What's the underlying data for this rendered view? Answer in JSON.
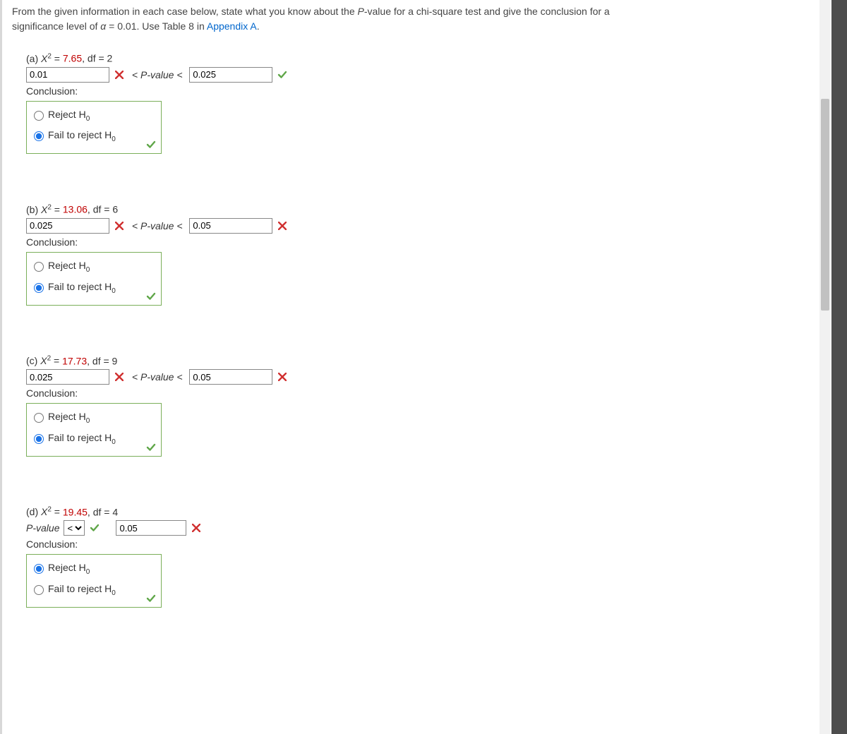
{
  "intro": {
    "line1_a": "From the given information in each case below, state what you know about the ",
    "line1_b": "P",
    "line1_c": "-value for a chi-square test and give the conclusion for a",
    "line2_a": "significance level of ",
    "alpha": "α",
    "line2_b": " = 0.01. Use Table 8 in ",
    "link": "Appendix A",
    "line2_c": "."
  },
  "common": {
    "pvalue_middle": "< P-value <",
    "pvalue_prefix": "P-value",
    "conclusion": "Conclusion:",
    "reject": "Reject H",
    "fail": "Fail to reject H",
    "sub0": "0"
  },
  "parts": {
    "a": {
      "label": "(a) X² = ",
      "stat": "7.65",
      "df": ", df = 2",
      "low": "0.01",
      "high": "0.025",
      "low_correct": false,
      "high_correct": true,
      "selected": "fail",
      "box_correct": true
    },
    "b": {
      "label": "(b) X² = ",
      "stat": "13.06",
      "df": ", df = 6",
      "low": "0.025",
      "high": "0.05",
      "low_correct": false,
      "high_correct": false,
      "selected": "fail",
      "box_correct": true
    },
    "c": {
      "label": "(c) X² = ",
      "stat": "17.73",
      "df": ", df = 9",
      "low": "0.025",
      "high": "0.05",
      "low_correct": false,
      "high_correct": false,
      "selected": "fail",
      "box_correct": true
    },
    "d": {
      "label": "(d) X² = ",
      "stat": "19.45",
      "df": ", df = 4",
      "sel_value": "<",
      "sel_correct": true,
      "val": "0.05",
      "val_correct": false,
      "selected": "reject",
      "box_correct": true
    }
  }
}
